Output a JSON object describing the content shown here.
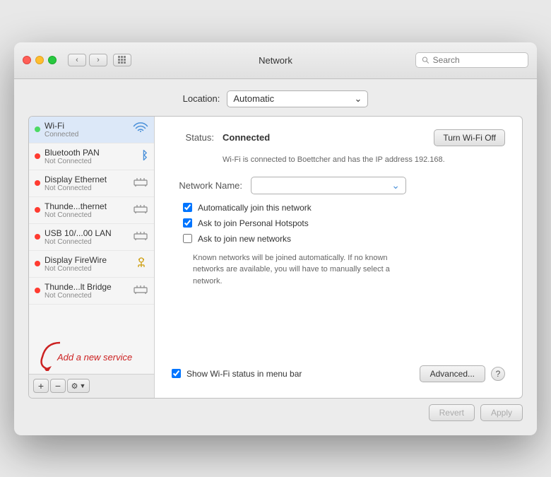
{
  "window": {
    "title": "Network",
    "search_placeholder": "Search"
  },
  "titlebar": {
    "back_label": "‹",
    "forward_label": "›",
    "grid_label": "⊞"
  },
  "location": {
    "label": "Location:",
    "value": "Automatic"
  },
  "sidebar": {
    "items": [
      {
        "id": "wifi",
        "name": "Wi-Fi",
        "status": "Connected",
        "active": true,
        "dot": "green",
        "icon": "wifi"
      },
      {
        "id": "bluetooth-pan",
        "name": "Bluetooth PAN",
        "status": "Not Connected",
        "active": false,
        "dot": "red",
        "icon": "bluetooth"
      },
      {
        "id": "display-ethernet",
        "name": "Display Ethernet",
        "status": "Not Connected",
        "active": false,
        "dot": "red",
        "icon": "ethernet"
      },
      {
        "id": "thunderbolt-ethernet",
        "name": "Thunde...thernet",
        "status": "Not Connected",
        "active": false,
        "dot": "red",
        "icon": "ethernet"
      },
      {
        "id": "usb-lan",
        "name": "USB 10/...00 LAN",
        "status": "Not Connected",
        "active": false,
        "dot": "red",
        "icon": "ethernet"
      },
      {
        "id": "display-firewire",
        "name": "Display FireWire",
        "status": "Not Connected",
        "active": false,
        "dot": "red",
        "icon": "firewire"
      },
      {
        "id": "thunderbolt-bridge",
        "name": "Thunde...lt Bridge",
        "status": "Not Connected",
        "active": false,
        "dot": "red",
        "icon": "ethernet"
      }
    ],
    "add_label": "+",
    "remove_label": "−",
    "gear_label": "⚙",
    "gear_arrow": "▼"
  },
  "panel": {
    "status_label": "Status:",
    "status_value": "Connected",
    "turn_wifi_btn": "Turn Wi-Fi Off",
    "status_desc": "Wi-Fi is connected to Boettcher and has the IP\naddress 192.168.",
    "network_name_label": "Network Name:",
    "checkboxes": [
      {
        "id": "auto-join",
        "label": "Automatically join this network",
        "checked": true
      },
      {
        "id": "personal-hotspot",
        "label": "Ask to join Personal Hotspots",
        "checked": true
      },
      {
        "id": "new-networks",
        "label": "Ask to join new networks",
        "checked": false
      }
    ],
    "known_networks_text": "Known networks will be joined automatically. If\nno known networks are available, you will have\nto manually select a network.",
    "show_wifi_checkbox": true,
    "show_wifi_label": "Show Wi-Fi status in menu bar",
    "advanced_btn": "Advanced...",
    "help_btn": "?",
    "revert_btn": "Revert",
    "apply_btn": "Apply"
  },
  "annotation": {
    "text": "Add a new service"
  }
}
